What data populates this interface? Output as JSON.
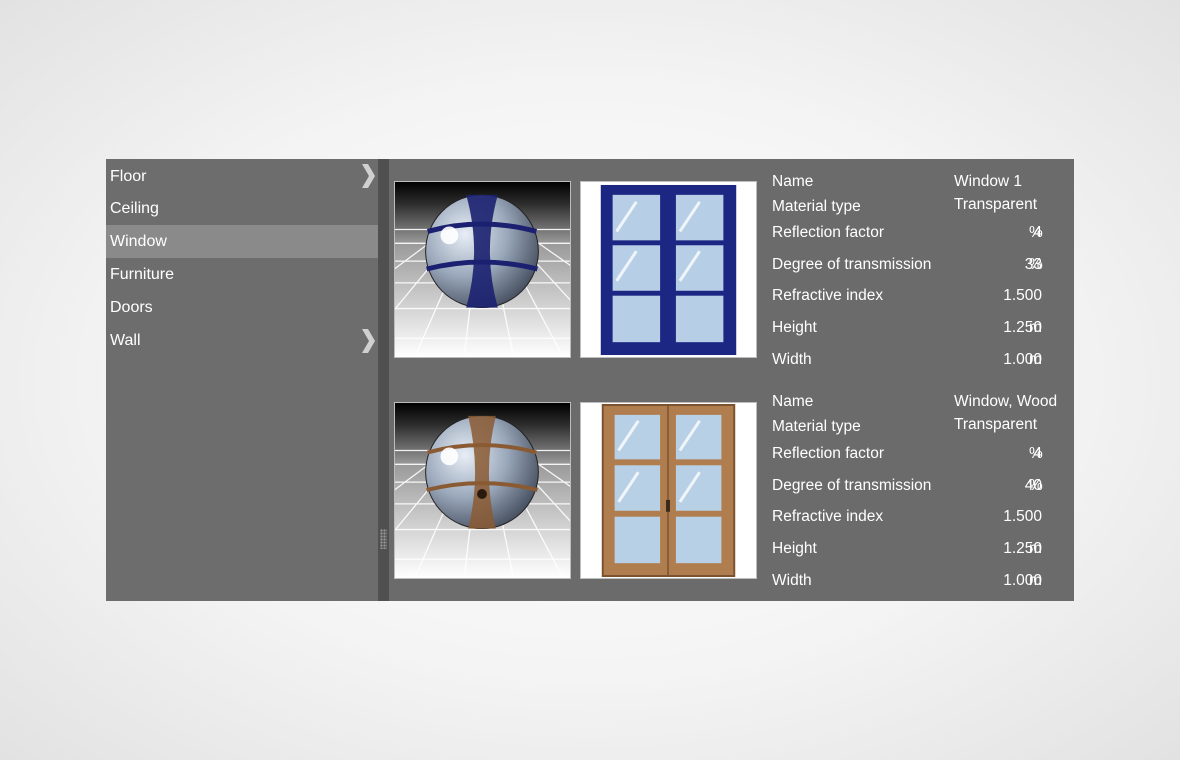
{
  "sidebar": {
    "items": [
      {
        "label": "Floor",
        "selected": false,
        "has_submenu": true
      },
      {
        "label": "Ceiling",
        "selected": false,
        "has_submenu": false
      },
      {
        "label": "Window",
        "selected": true,
        "has_submenu": false
      },
      {
        "label": "Furniture",
        "selected": false,
        "has_submenu": false
      },
      {
        "label": "Doors",
        "selected": false,
        "has_submenu": false
      },
      {
        "label": "Wall",
        "selected": false,
        "has_submenu": true
      }
    ],
    "submenu_icon": "chevron-right-icon"
  },
  "materials": [
    {
      "frame_color": "#1f2a7a",
      "properties": [
        {
          "label": "Name",
          "value": "Window 1",
          "unit": ""
        },
        {
          "label": "Material type",
          "value": "Transparent",
          "unit": ""
        },
        {
          "label": "Reflection factor",
          "value": "4",
          "unit": "%"
        },
        {
          "label": "Degree of transmission",
          "value": "33",
          "unit": "%"
        },
        {
          "label": "Refractive index",
          "value": "1.500",
          "unit": ""
        },
        {
          "label": "Height",
          "value": "1.250",
          "unit": "m"
        },
        {
          "label": "Width",
          "value": "1.000",
          "unit": "m"
        }
      ]
    },
    {
      "frame_color": "#a8764a",
      "properties": [
        {
          "label": "Name",
          "value": "Window, Wood",
          "unit": ""
        },
        {
          "label": "Material type",
          "value": "Transparent",
          "unit": ""
        },
        {
          "label": "Reflection factor",
          "value": "4",
          "unit": "%"
        },
        {
          "label": "Degree of transmission",
          "value": "40",
          "unit": "%"
        },
        {
          "label": "Refractive index",
          "value": "1.500",
          "unit": ""
        },
        {
          "label": "Height",
          "value": "1.250",
          "unit": "m"
        },
        {
          "label": "Width",
          "value": "1.000",
          "unit": "m"
        }
      ]
    }
  ]
}
